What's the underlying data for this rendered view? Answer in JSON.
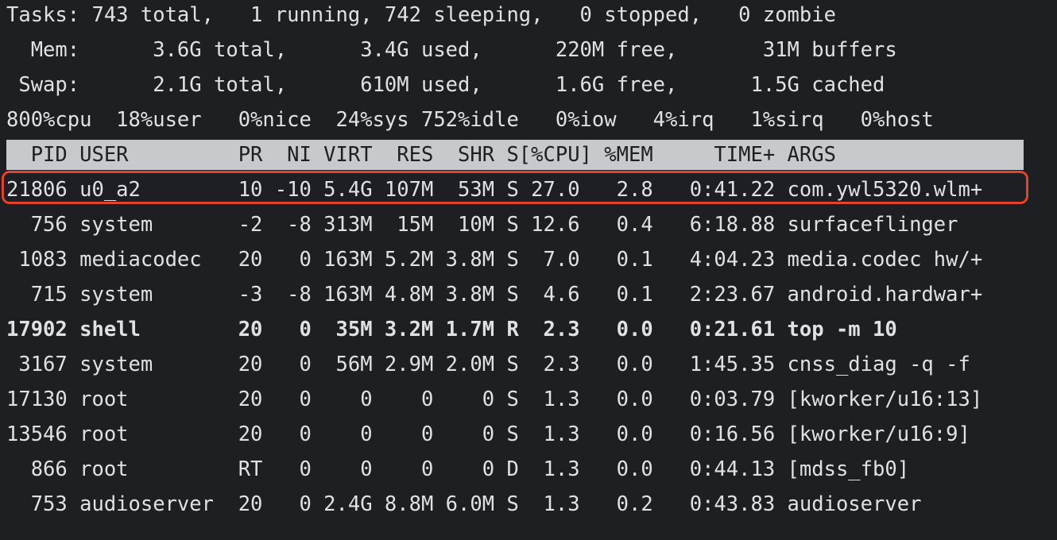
{
  "summary": {
    "tasks": "Tasks: 743 total,   1 running, 742 sleeping,   0 stopped,   0 zombie",
    "mem": "  Mem:      3.6G total,      3.4G used,      220M free,       31M buffers",
    "swap": " Swap:      2.1G total,      610M used,      1.6G free,      1.5G cached",
    "cpu": "800%cpu  18%user   0%nice  24%sys 752%idle   0%iow   4%irq   1%sirq   0%host"
  },
  "header": "  PID USER         PR  NI VIRT  RES  SHR S[%CPU] %MEM     TIME+ ARGS",
  "rows": [
    "21806 u0_a2        10 -10 5.4G 107M  53M S 27.0   2.8   0:41.22 com.ywl5320.wlm+",
    "  756 system       -2  -8 313M  15M  10M S 12.6   0.4   6:18.88 surfaceflinger",
    " 1083 mediacodec   20   0 163M 5.2M 3.8M S  7.0   0.1   4:04.23 media.codec hw/+",
    "  715 system       -3  -8 163M 4.8M 3.8M S  4.6   0.1   2:23.67 android.hardwar+",
    "17902 shell        20   0  35M 3.2M 1.7M R  2.3   0.0   0:21.61 top -m 10",
    " 3167 system       20   0  56M 2.9M 2.0M S  2.3   0.0   1:45.35 cnss_diag -q -f",
    "17130 root         20   0    0    0    0 S  1.3   0.0   0:03.79 [kworker/u16:13]",
    "13546 root         20   0    0    0    0 S  1.3   0.0   0:16.56 [kworker/u16:9]",
    "  866 root         RT   0    0    0    0 D  1.3   0.0   0:44.13 [mdss_fb0]",
    "  753 audioserver  20   0 2.4G 8.8M 6.0M S  1.3   0.2   0:43.83 audioserver"
  ],
  "colors": {
    "background": "#1e1f22",
    "text": "#dfe1e5",
    "header_bar": "#c8c9cc",
    "highlight_border": "#e5422b"
  }
}
